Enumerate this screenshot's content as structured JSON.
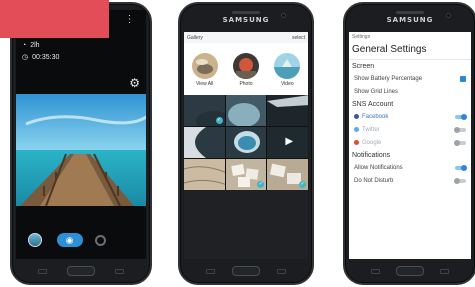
{
  "camera": {
    "status_icons": [
      "bolt-icon",
      "battery-icon",
      "wifi-icon",
      "more-vert-icon"
    ],
    "timer_value": "2lh",
    "clock_value": "00:35:30",
    "shutter_icon": "camera-icon"
  },
  "phones": {
    "brand": "SAMSUNG"
  },
  "gallery": {
    "header_title": "Gallery",
    "header_action": "select",
    "albums": [
      {
        "label": "View All"
      },
      {
        "label": "Photo"
      },
      {
        "label": "Video"
      }
    ]
  },
  "settings": {
    "header": "Settings",
    "title": "General Settings",
    "screen_section": "Screen",
    "show_battery_label": "Show Battery Percentage",
    "show_battery_checked": true,
    "show_grid_label": "Show Grid Lines",
    "show_grid_checked": false,
    "sns_section": "SNS Account",
    "facebook_label": "Facebook",
    "facebook_on": true,
    "twitter_label": "Twitter",
    "twitter_on": false,
    "google_label": "Google",
    "google_on": false,
    "notifications_section": "Notifications",
    "allow_notifications_label": "Allow Notifications",
    "allow_notifications_on": true,
    "dnd_label": "Do Not Disturb",
    "dnd_on": false
  },
  "colors": {
    "accent": "#2f86d6",
    "banner": "#e34d58",
    "gallery_check": "#3fb6c6"
  }
}
